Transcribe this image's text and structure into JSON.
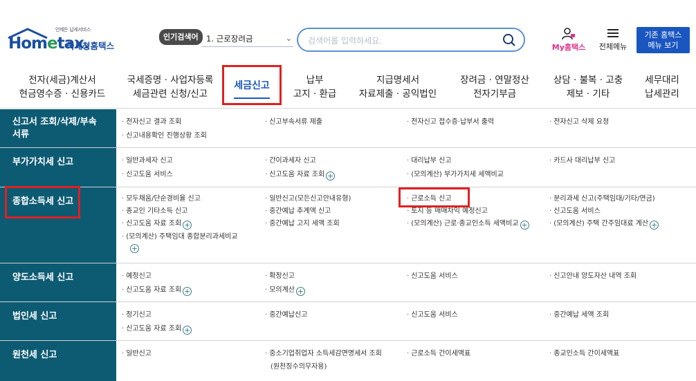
{
  "header": {
    "logo_slogan": "언제든 납세서비스",
    "logo_word_a": "Hom",
    "logo_word_e": "e",
    "logo_word_b": "tax.",
    "logo_kr": "국세청홈택스",
    "popular_badge": "인기검색어",
    "popular_value": "1. 근로장려금",
    "search_placeholder": "검색어를 입력하세요.",
    "my_hometax": "My홈택스",
    "all_menu": "전체메뉴",
    "old_menu_line1": "기존 홈택스",
    "old_menu_line2": "메뉴 보기"
  },
  "gnb": [
    {
      "l1": "전자(세금)계산서",
      "l2": "현금영수증 · 신용카드"
    },
    {
      "l1": "국세증명 · 사업자등록",
      "l2": "세금관련 신청/신고"
    },
    {
      "l1": "세금신고",
      "l2": ""
    },
    {
      "l1": "납부",
      "l2": "고지 · 환급"
    },
    {
      "l1": "지급명세서",
      "l2": "자료제출 · 공익법인"
    },
    {
      "l1": "장려금 · 연말정산",
      "l2": "전자기부금"
    },
    {
      "l1": "상담 · 불복 · 고충",
      "l2": "제보 · 기타"
    },
    {
      "l1": "세무대리",
      "l2": "납세관리"
    }
  ],
  "rows": [
    {
      "label": "신고서 조회/삭제/부속서류",
      "items": [
        "전자신고 결과 조회",
        "신고부속서류 제출",
        "전자신고 접수증·납부서 출력",
        "전자신고 삭제 요청",
        "신고내용확인 진행상황 조회"
      ]
    },
    {
      "label": "부가가치세 신고",
      "items": [
        "일반과세자 신고",
        "간이과세자 신고",
        "대리납부 신고",
        "카드사 대리납부 신고",
        "신고도움 서비스",
        "신고도움 자료 조회",
        "(모의계산) 부가가치세 세액비교"
      ]
    },
    {
      "label": "종합소득세 신고",
      "items": [
        "모두채움/단순경비율 신고",
        "일반신고(모든신고안내유형)",
        "근로소득 신고",
        "분리과세 신고(주택임대/기타/연금)",
        "종교인 기타소득 신고",
        "중간예납 추계액 신고",
        "토지 등 매매차익 예정신고",
        "신고도움 서비스",
        "신고도움 자료 조회",
        "중간예납 고지 세액 조회",
        "(모의계산) 근로·종교인소득 세액비교",
        "(모의계산) 주택 간주임대료 계산",
        "(모의계산) 주택임대 종합분리과세비교"
      ]
    },
    {
      "label": "양도소득세 신고",
      "items": [
        "예정신고",
        "확정신고",
        "신고도움 서비스",
        "신고안내 양도자산 내역 조회",
        "신고도움 자료 조회",
        "모의계산"
      ]
    },
    {
      "label": "법인세 신고",
      "items": [
        "정기신고",
        "중간예납신고",
        "신고도움 서비스",
        "중간예납 세액 조회",
        "신고도움 자료 조회"
      ]
    },
    {
      "label": "원천세 신고",
      "items": [
        "일반신고",
        "중소기업취업자 소득세감면명세서 조회",
        "(원천징수의무자용)",
        "근로소득 간이세액표",
        "종교인소득 간이세액표"
      ]
    }
  ],
  "plus_glyph": "+"
}
